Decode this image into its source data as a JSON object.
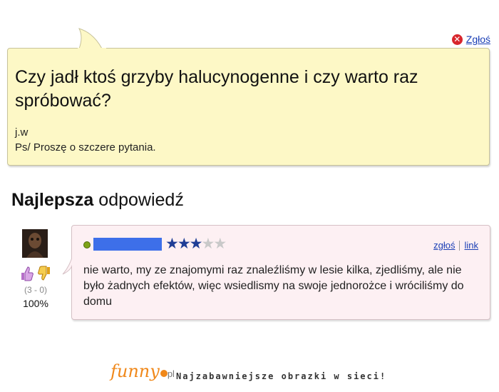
{
  "report": {
    "label": "Zgłoś"
  },
  "question": {
    "title": "Czy jadł ktoś grzyby halucynogenne i czy warto raz spróbować?",
    "details_line1": "j.w",
    "details_line2": "Ps/ Proszę o szczere pytania."
  },
  "best_answer": {
    "heading_bold": "Najlepsza",
    "heading_rest": "odpowiedź"
  },
  "answerer": {
    "votes": "(3 - 0)",
    "percent": "100%",
    "rating_stars": 3,
    "rating_max": 5,
    "status_color": "#7ea318"
  },
  "answer": {
    "report_label": "zgłoś",
    "link_label": "link",
    "text": "nie warto, my ze znajomymi raz znaleźliśmy w lesie kilka, zjedliśmy, ale nie było żadnych efektów, więc wsiedlismy na swoje jednorożce i wróciliśmy do domu"
  },
  "footer": {
    "logo_text": "funny",
    "logo_suffix": "pl",
    "tagline": "Najzabawniejsze obrazki w sieci!"
  },
  "colors": {
    "question_bg": "#fdf8c6",
    "answer_bg": "#fdf0f3",
    "link": "#1b3fb5",
    "accent_orange": "#f0881a"
  },
  "icons": [
    "close-circle-icon",
    "thumbs-up-icon",
    "thumbs-down-icon",
    "star-icon",
    "user-avatar"
  ]
}
